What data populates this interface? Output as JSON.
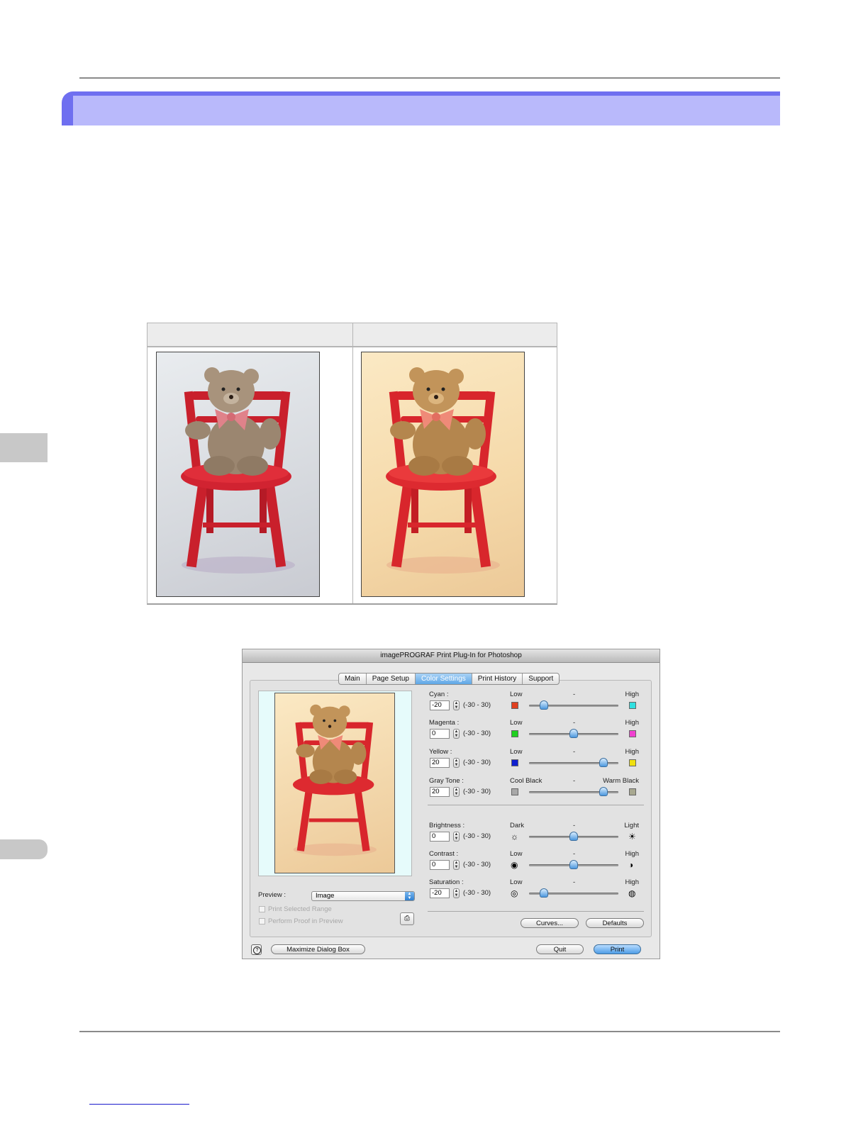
{
  "header_banner": {
    "color": "#b9b9fb",
    "accent": "#6f6ff0"
  },
  "comparison": {
    "headers": [
      "",
      ""
    ],
    "images": [
      {
        "name": "teddy-bear-original",
        "tone": "neutral"
      },
      {
        "name": "teddy-bear-adjusted",
        "tone": "warm"
      }
    ]
  },
  "dialog": {
    "title": "imagePROGRAF Print Plug-In for Photoshop",
    "tabs": [
      {
        "label": "Main",
        "selected": false
      },
      {
        "label": "Page Setup",
        "selected": false
      },
      {
        "label": "Color Settings",
        "selected": true
      },
      {
        "label": "Print History",
        "selected": false
      },
      {
        "label": "Support",
        "selected": false
      }
    ],
    "range_text": "(-30 - 30)",
    "controls": [
      {
        "label": "Cyan :",
        "value": "-20",
        "low": "Low",
        "mid": "-",
        "high": "High",
        "low_color": "#e04020",
        "high_color": "#30e0e0",
        "level": -20
      },
      {
        "label": "Magenta :",
        "value": "0",
        "low": "Low",
        "mid": "-",
        "high": "High",
        "low_color": "#20d020",
        "high_color": "#f040d0",
        "level": 0
      },
      {
        "label": "Yellow :",
        "value": "20",
        "low": "Low",
        "mid": "-",
        "high": "High",
        "low_color": "#1020d0",
        "high_color": "#f0e010",
        "level": 20
      },
      {
        "label": "Gray Tone :",
        "value": "20",
        "low": "Cool Black",
        "mid": "-",
        "high": "Warm Black",
        "low_color": "#a8a8a8",
        "high_color": "#a8a890",
        "level": 20
      },
      {
        "label": "Brightness :",
        "value": "0",
        "low": "Dark",
        "mid": "-",
        "high": "Light",
        "low_icon": "dim-sun-icon",
        "high_icon": "bright-sun-icon",
        "level": 0
      },
      {
        "label": "Contrast :",
        "value": "0",
        "low": "Low",
        "mid": "-",
        "high": "High",
        "low_icon": "low-contrast-icon",
        "high_icon": "high-contrast-icon",
        "level": 0
      },
      {
        "label": "Saturation :",
        "value": "-20",
        "low": "Low",
        "mid": "-",
        "high": "High",
        "low_icon": "low-saturation-icon",
        "high_icon": "high-saturation-icon",
        "level": -20
      }
    ],
    "preview_label": "Preview :",
    "preview_value": "Image",
    "print_selected_range": "Print Selected Range",
    "perform_proof": "Perform Proof in Preview",
    "curves_button": "Curves...",
    "defaults_button": "Defaults",
    "maximize_button": "Maximize Dialog Box",
    "quit_button": "Quit",
    "print_button": "Print"
  }
}
